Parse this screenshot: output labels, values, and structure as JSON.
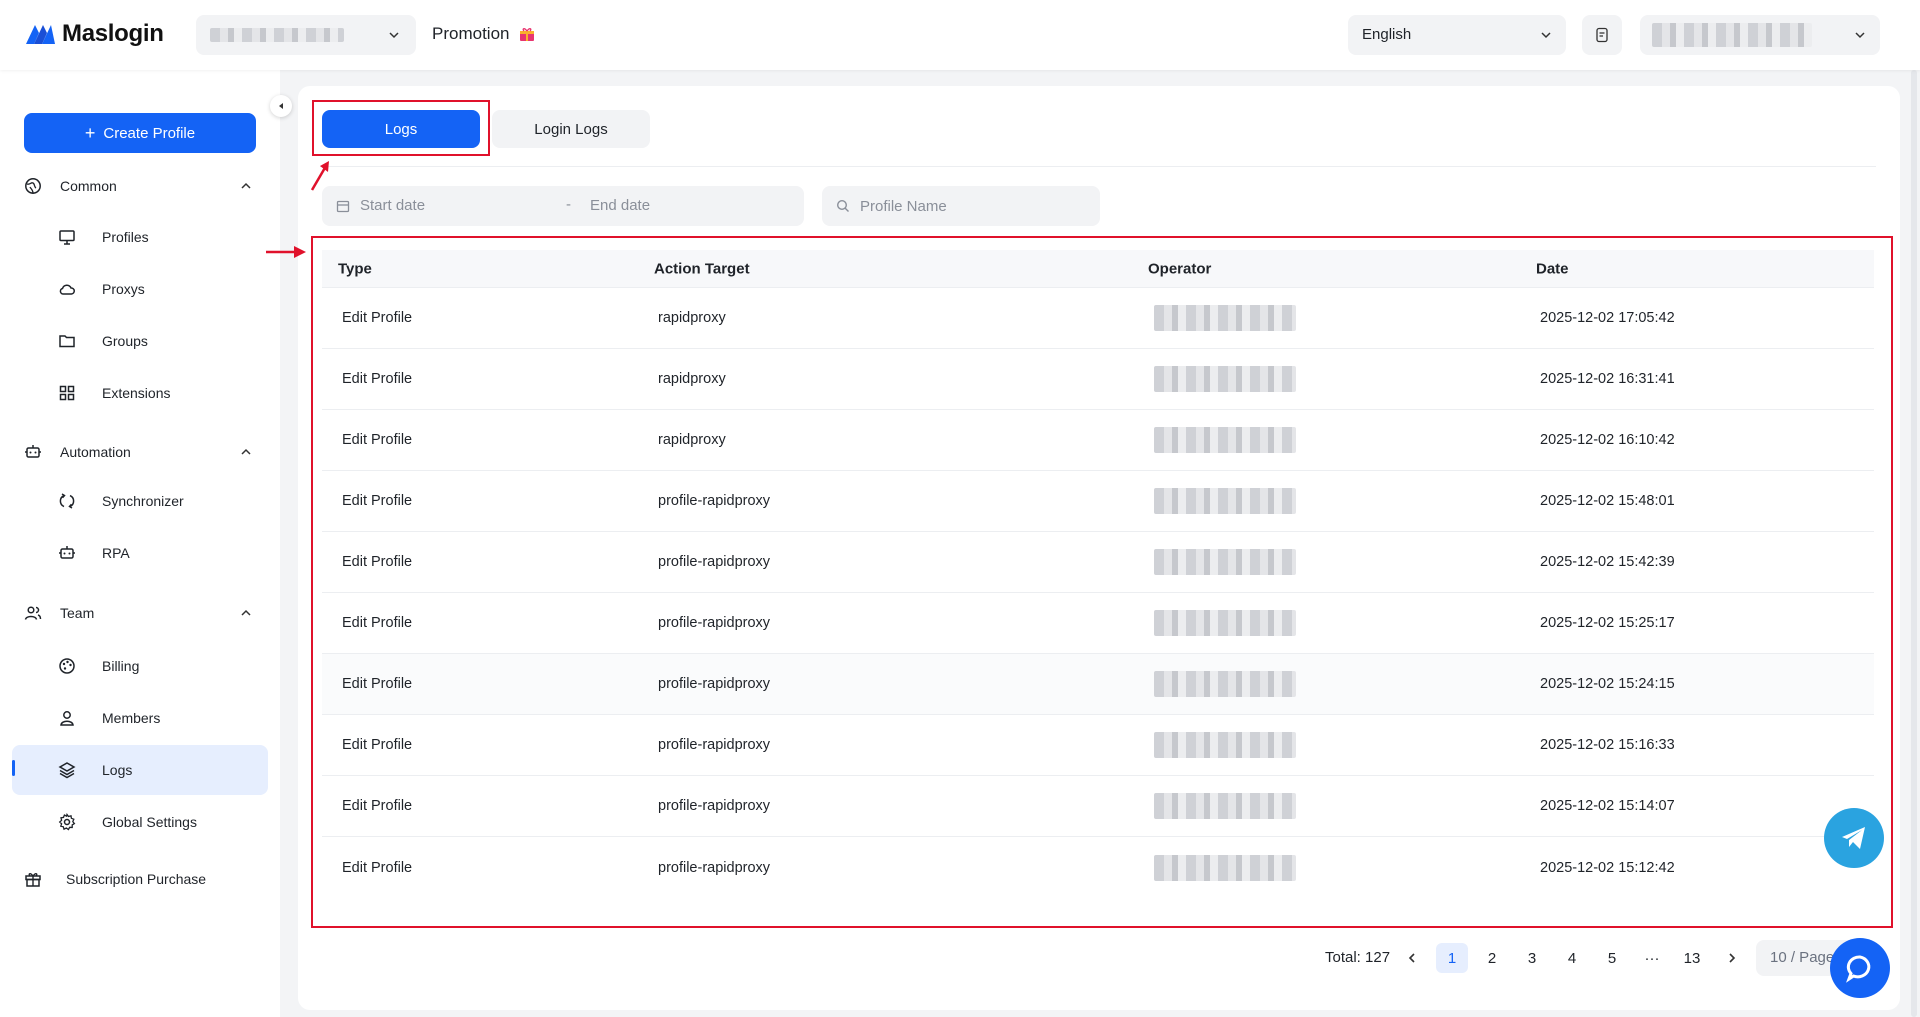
{
  "header": {
    "brand": "Maslogin",
    "promotion": "Promotion",
    "language": "English"
  },
  "sidebar": {
    "create_profile": "Create Profile",
    "groups": [
      {
        "label": "Common",
        "items": [
          "Profiles",
          "Proxys",
          "Groups",
          "Extensions"
        ]
      },
      {
        "label": "Automation",
        "items": [
          "Synchronizer",
          "RPA"
        ]
      },
      {
        "label": "Team",
        "items": [
          "Billing",
          "Members",
          "Logs",
          "Global Settings"
        ]
      }
    ],
    "common": {
      "label": "Common",
      "profiles": "Profiles",
      "proxys": "Proxys",
      "groups": "Groups",
      "extensions": "Extensions"
    },
    "automation": {
      "label": "Automation",
      "synchronizer": "Synchronizer",
      "rpa": "RPA"
    },
    "team": {
      "label": "Team",
      "billing": "Billing",
      "members": "Members",
      "logs": "Logs",
      "global_settings": "Global Settings"
    },
    "subscription": "Subscription Purchase",
    "active_item": "Logs"
  },
  "tabs": {
    "logs": "Logs",
    "login_logs": "Login Logs",
    "active": "Logs"
  },
  "filters": {
    "start_placeholder": "Start date",
    "separator": "-",
    "end_placeholder": "End date",
    "profile_placeholder": "Profile Name"
  },
  "table": {
    "columns": {
      "type": "Type",
      "target": "Action Target",
      "operator": "Operator",
      "date": "Date"
    },
    "rows": [
      {
        "type": "Edit Profile",
        "target": "rapidproxy",
        "date": "2025-12-02 17:05:42"
      },
      {
        "type": "Edit Profile",
        "target": "rapidproxy",
        "date": "2025-12-02 16:31:41"
      },
      {
        "type": "Edit Profile",
        "target": "rapidproxy",
        "date": "2025-12-02 16:10:42"
      },
      {
        "type": "Edit Profile",
        "target": "profile-rapidproxy",
        "date": "2025-12-02 15:48:01"
      },
      {
        "type": "Edit Profile",
        "target": "profile-rapidproxy",
        "date": "2025-12-02 15:42:39"
      },
      {
        "type": "Edit Profile",
        "target": "profile-rapidproxy",
        "date": "2025-12-02 15:25:17"
      },
      {
        "type": "Edit Profile",
        "target": "profile-rapidproxy",
        "date": "2025-12-02 15:24:15"
      },
      {
        "type": "Edit Profile",
        "target": "profile-rapidproxy",
        "date": "2025-12-02 15:16:33"
      },
      {
        "type": "Edit Profile",
        "target": "profile-rapidproxy",
        "date": "2025-12-02 15:14:07"
      },
      {
        "type": "Edit Profile",
        "target": "profile-rapidproxy",
        "date": "2025-12-02 15:12:42"
      }
    ]
  },
  "pagination": {
    "total": "Total: 127",
    "pages": [
      "1",
      "2",
      "3",
      "4",
      "5",
      "···",
      "13"
    ],
    "current": "1",
    "page_size": "10 / Page"
  },
  "colors": {
    "primary": "#1463f5",
    "annotation": "#e0112b",
    "telegram": "#2aa3e0"
  }
}
